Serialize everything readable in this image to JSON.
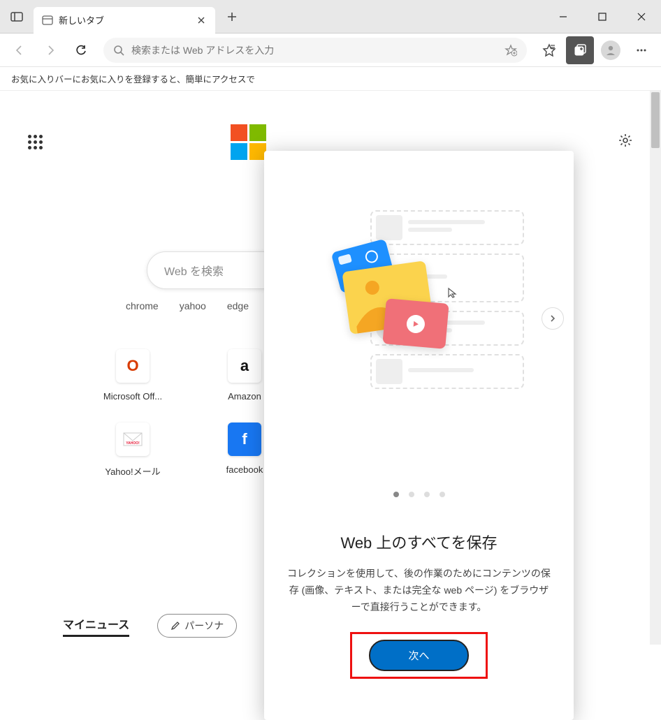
{
  "titlebar": {
    "tab_title": "新しいタブ"
  },
  "toolbar": {
    "omnibox_placeholder": "検索または Web アドレスを入力"
  },
  "favorites_bar": {
    "hint": "お気に入りバーにお気に入りを登録すると、簡単にアクセスで"
  },
  "ntp": {
    "search_placeholder": "Web を検索",
    "search_links": [
      "chrome",
      "yahoo",
      "edge"
    ],
    "tiles": [
      {
        "label": "Microsoft Off...",
        "icon": "office"
      },
      {
        "label": "Amazon",
        "icon": "amazon"
      },
      {
        "label": "Yahoo!メール",
        "icon": "yahoo-mail"
      },
      {
        "label": "facebook",
        "icon": "facebook"
      }
    ],
    "my_news": "マイニュース",
    "personalize": "パーソナ"
  },
  "popover": {
    "title": "Web 上のすべてを保存",
    "description": "コレクションを使用して、後の作業のためにコンテンツの保存 (画像、テキスト、または完全な web ページ) をブラウザーで直接行うことができます。",
    "next_button": "次へ",
    "dot_count": 4,
    "active_dot": 0
  }
}
